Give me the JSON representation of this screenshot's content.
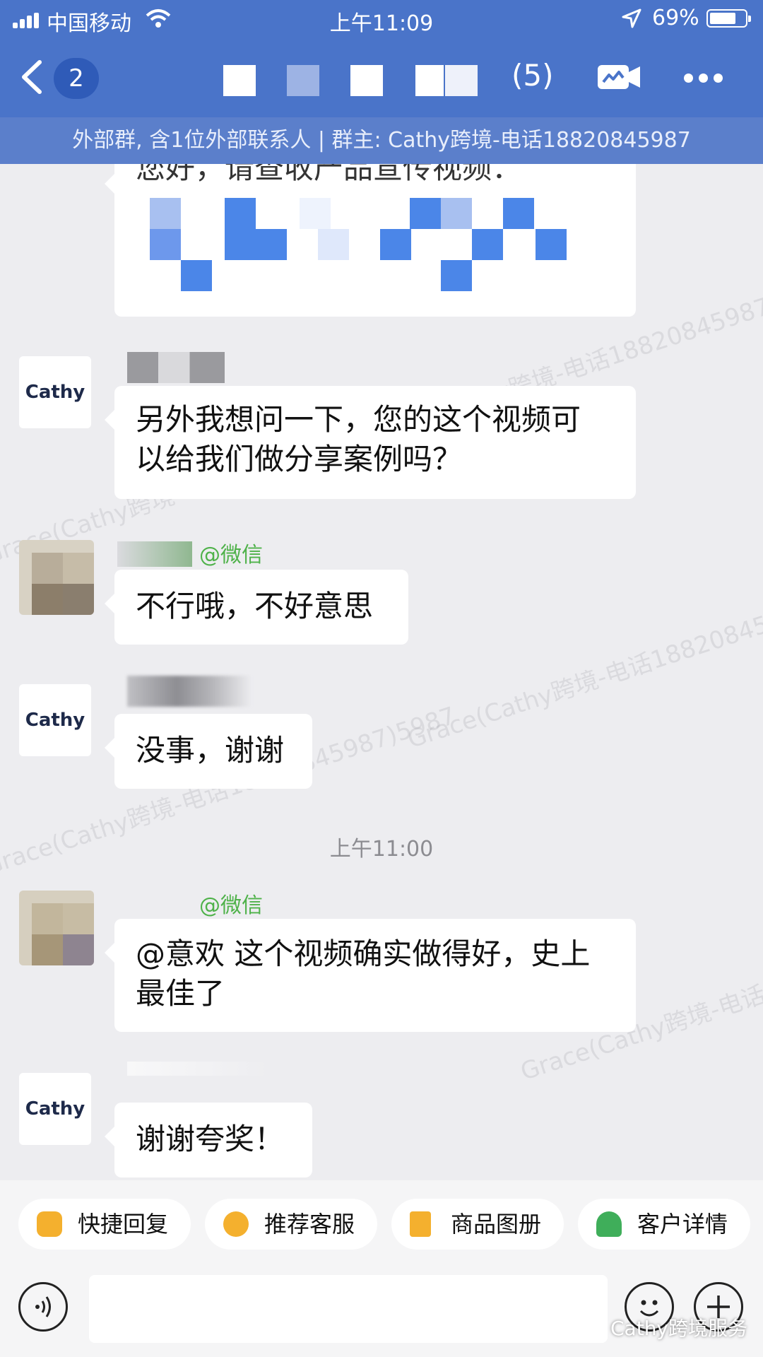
{
  "status_bar": {
    "carrier": "中国移动",
    "time": "上午11:09",
    "battery_pct": "69%",
    "icons": [
      "signal-icon",
      "wifi-icon",
      "location-icon",
      "battery-icon"
    ]
  },
  "nav": {
    "unread_count": "2",
    "member_count": "(5)",
    "subtitle": "外部群, 含1位外部联系人 | 群主: Cathy跨境-电话18820845987",
    "icons": [
      "back-icon",
      "video-meeting-icon",
      "more-icon"
    ]
  },
  "messages": [
    {
      "sender": "",
      "text": "您好，请查收产品宣传视频："
    },
    {
      "sender": "",
      "avatar_label": "Cathy",
      "text_line1": "另外我想问一下，您的这个视频可",
      "text_line2": "以给我们做分享案例吗？"
    },
    {
      "sender": "@微信",
      "text": "不行哦，不好意思"
    },
    {
      "sender": "",
      "avatar_label": "Cathy",
      "text": "没事，谢谢"
    },
    {
      "sender": "@微信",
      "text_line1": "@意欢 这个视频确实做得好，史上",
      "text_line2": "最佳了"
    },
    {
      "sender": "",
      "avatar_label": "Cathy",
      "text": "谢谢夸奖！"
    }
  ],
  "timestamp": "上午11:00",
  "watermark": "Grace(Cathy跨境-电话18820845987)5987",
  "quick_actions": [
    {
      "label": "快捷回复",
      "icon": "quick-reply-icon",
      "color": "#f4b02e"
    },
    {
      "label": "推荐客服",
      "icon": "recommend-agent-icon",
      "color": "#f4b02e"
    },
    {
      "label": "商品图册",
      "icon": "product-album-icon",
      "color": "#f4b02e"
    },
    {
      "label": "客户详情",
      "icon": "customer-detail-icon",
      "color": "#3fae5a"
    }
  ],
  "input": {
    "placeholder": "",
    "icons": [
      "voice-icon",
      "emoji-icon",
      "plus-icon"
    ]
  },
  "corner_overlay": "Cathy跨境服务",
  "colors": {
    "header": "#4a74c9",
    "subheader": "#5b7fcb",
    "background": "#ededf0",
    "sender_green": "#4fb24a"
  }
}
